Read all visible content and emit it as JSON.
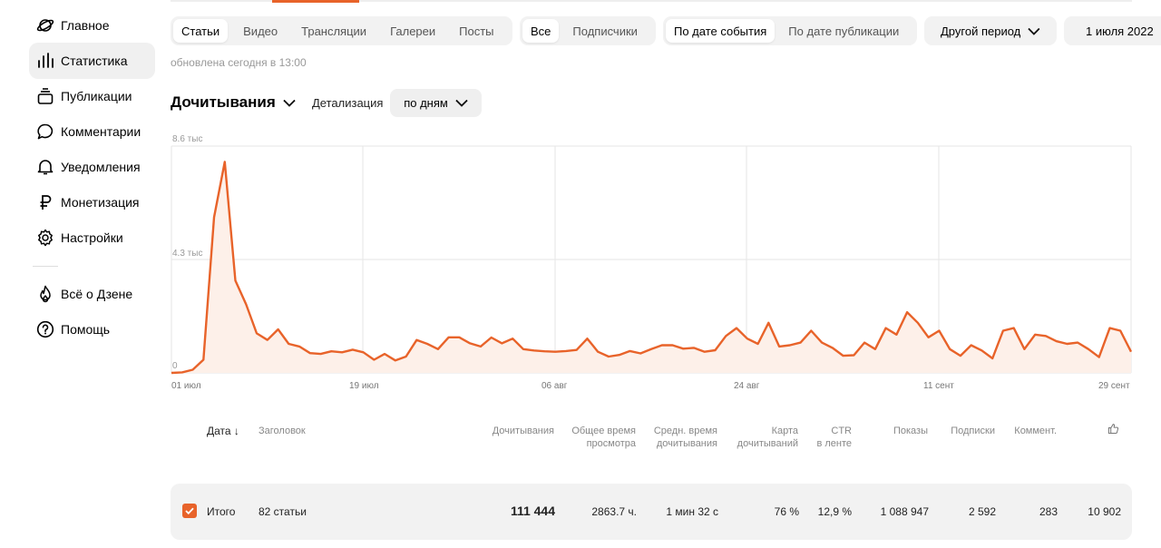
{
  "sidebar": {
    "items": [
      {
        "label": "Главное",
        "icon": "planet-icon"
      },
      {
        "label": "Статистика",
        "icon": "bar-chart-icon"
      },
      {
        "label": "Публикации",
        "icon": "stack-icon"
      },
      {
        "label": "Комментарии",
        "icon": "comment-icon"
      },
      {
        "label": "Уведомления",
        "icon": "bell-icon"
      },
      {
        "label": "Монетизация",
        "icon": "ruble-icon"
      },
      {
        "label": "Настройки",
        "icon": "gear-icon"
      },
      {
        "label": "Всё о Дзене",
        "icon": "flame-icon"
      },
      {
        "label": "Помощь",
        "icon": "help-icon"
      }
    ]
  },
  "filters": {
    "content_types": [
      "Статьи",
      "Видео",
      "Трансляции",
      "Галереи",
      "Посты"
    ],
    "audience": [
      "Все",
      "Подписчики"
    ],
    "date_mode": [
      "По дате события",
      "По дате публикации"
    ],
    "period_label": "Другой период",
    "date_label": "1 июля 2022"
  },
  "updated": "обновлена сегодня в 13:00",
  "metric": {
    "title": "Дочитывания",
    "detail_label": "Детализация",
    "detail_value": "по дням"
  },
  "chart_data": {
    "type": "area",
    "y_ticks": [
      "8.6 тыс",
      "4.3 тыс",
      "0"
    ],
    "ylim": [
      0,
      8600
    ],
    "x_ticks": [
      "01 июл",
      "19 июл",
      "06 авг",
      "24 авг",
      "11 сент",
      "29 сент"
    ],
    "x_start": "2022-07-01",
    "color": "#e8632a",
    "values": [
      0,
      20,
      120,
      500,
      5900,
      8000,
      3500,
      2600,
      1500,
      1250,
      1650,
      1100,
      1000,
      750,
      720,
      820,
      780,
      880,
      780,
      500,
      720,
      470,
      620,
      1250,
      1100,
      900,
      1350,
      1350,
      1120,
      1000,
      1340,
      1120,
      1300,
      900,
      850,
      820,
      800,
      830,
      870,
      1300,
      800,
      620,
      680,
      830,
      740,
      900,
      1050,
      1050,
      920,
      950,
      800,
      860,
      1400,
      1700,
      1300,
      1100,
      1900,
      1000,
      1050,
      1150,
      1600,
      1150,
      950,
      650,
      670,
      1150,
      900,
      1700,
      1450,
      2300,
      1900,
      1350,
      1600,
      900,
      650,
      1050,
      850,
      550,
      1600,
      1700,
      900,
      1450,
      1400,
      1200,
      1100,
      1150,
      900,
      600,
      1700,
      1600,
      800
    ]
  },
  "table": {
    "headers": {
      "date": "Дата",
      "title": "Заголовок",
      "readthroughs": "Дочитывания",
      "total_time": [
        "Общее время",
        "просмотра"
      ],
      "avg_time": [
        "Средн. время",
        "дочитывания"
      ],
      "readthrough_map": [
        "Карта",
        "дочитываний"
      ],
      "ctr": [
        "CTR",
        "в ленте"
      ],
      "impressions": "Показы",
      "subscriptions": "Подписки",
      "comments": "Коммент."
    },
    "total": {
      "label": "Итого",
      "articles": "82 статьи",
      "readthroughs": "111 444",
      "total_time": "2863.7 ч.",
      "avg_time": "1 мин 32 с",
      "readthrough_map": "76 %",
      "ctr": "12,9 %",
      "impressions": "1 088 947",
      "subscriptions": "2 592",
      "comments": "283",
      "likes": "10 902"
    }
  }
}
